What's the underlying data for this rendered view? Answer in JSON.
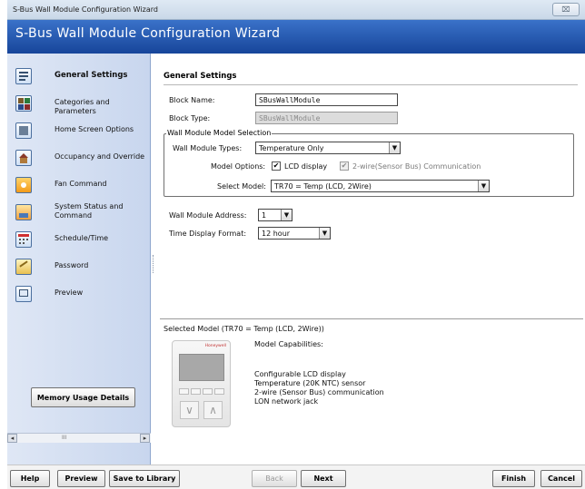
{
  "window": {
    "title": "S-Bus Wall Module Configuration Wizard",
    "close_glyph": "⌧"
  },
  "banner": {
    "title": "S-Bus Wall Module Configuration Wizard"
  },
  "sidebar": {
    "items": [
      {
        "label": "General Settings",
        "icon": "general-settings-icon"
      },
      {
        "label": "Categories and Parameters",
        "icon": "categories-icon"
      },
      {
        "label": "Home Screen Options",
        "icon": "home-screen-icon"
      },
      {
        "label": "Occupancy and Override",
        "icon": "occupancy-icon"
      },
      {
        "label": "Fan Command",
        "icon": "fan-icon"
      },
      {
        "label": "System Status and Command",
        "icon": "system-status-icon"
      },
      {
        "label": "Schedule/Time",
        "icon": "calendar-icon"
      },
      {
        "label": "Password",
        "icon": "password-icon"
      },
      {
        "label": "Preview",
        "icon": "preview-icon"
      }
    ],
    "memory_button": "Memory Usage Details",
    "scroll_thumb": "III"
  },
  "general": {
    "heading": "General Settings",
    "block_name_label": "Block Name:",
    "block_name_value": "SBusWallModule",
    "block_type_label": "Block Type:",
    "block_type_value": "SBusWallModule",
    "group_legend": "Wall Module Model Selection",
    "wmt_label": "Wall Module Types:",
    "wmt_value": "Temperature Only",
    "model_options_label": "Model Options:",
    "lcd_label": "LCD display",
    "twowire_label": "2-wire(Sensor Bus) Communication",
    "select_model_label": "Select Model:",
    "select_model_value": "TR70 = Temp (LCD, 2Wire)",
    "address_label": "Wall Module Address:",
    "address_value": "1",
    "time_format_label": "Time Display Format:",
    "time_format_value": "12 hour"
  },
  "selected_model": {
    "title": "Selected Model (TR70 = Temp (LCD, 2Wire))",
    "capabilities_label": "Model Capabilities:",
    "capabilities": [
      "Configurable LCD display",
      "Temperature (20K NTC) sensor",
      "2-wire (Sensor Bus) communication",
      "LON network jack"
    ],
    "brand": "Honeywell"
  },
  "footer": {
    "help": "Help",
    "preview": "Preview",
    "save": "Save to Library",
    "back": "Back",
    "next": "Next",
    "finish": "Finish",
    "cancel": "Cancel"
  },
  "colors": {
    "banner": "#17459a",
    "sidebar": "#c8d6ee",
    "accent_red": "#c03030"
  }
}
